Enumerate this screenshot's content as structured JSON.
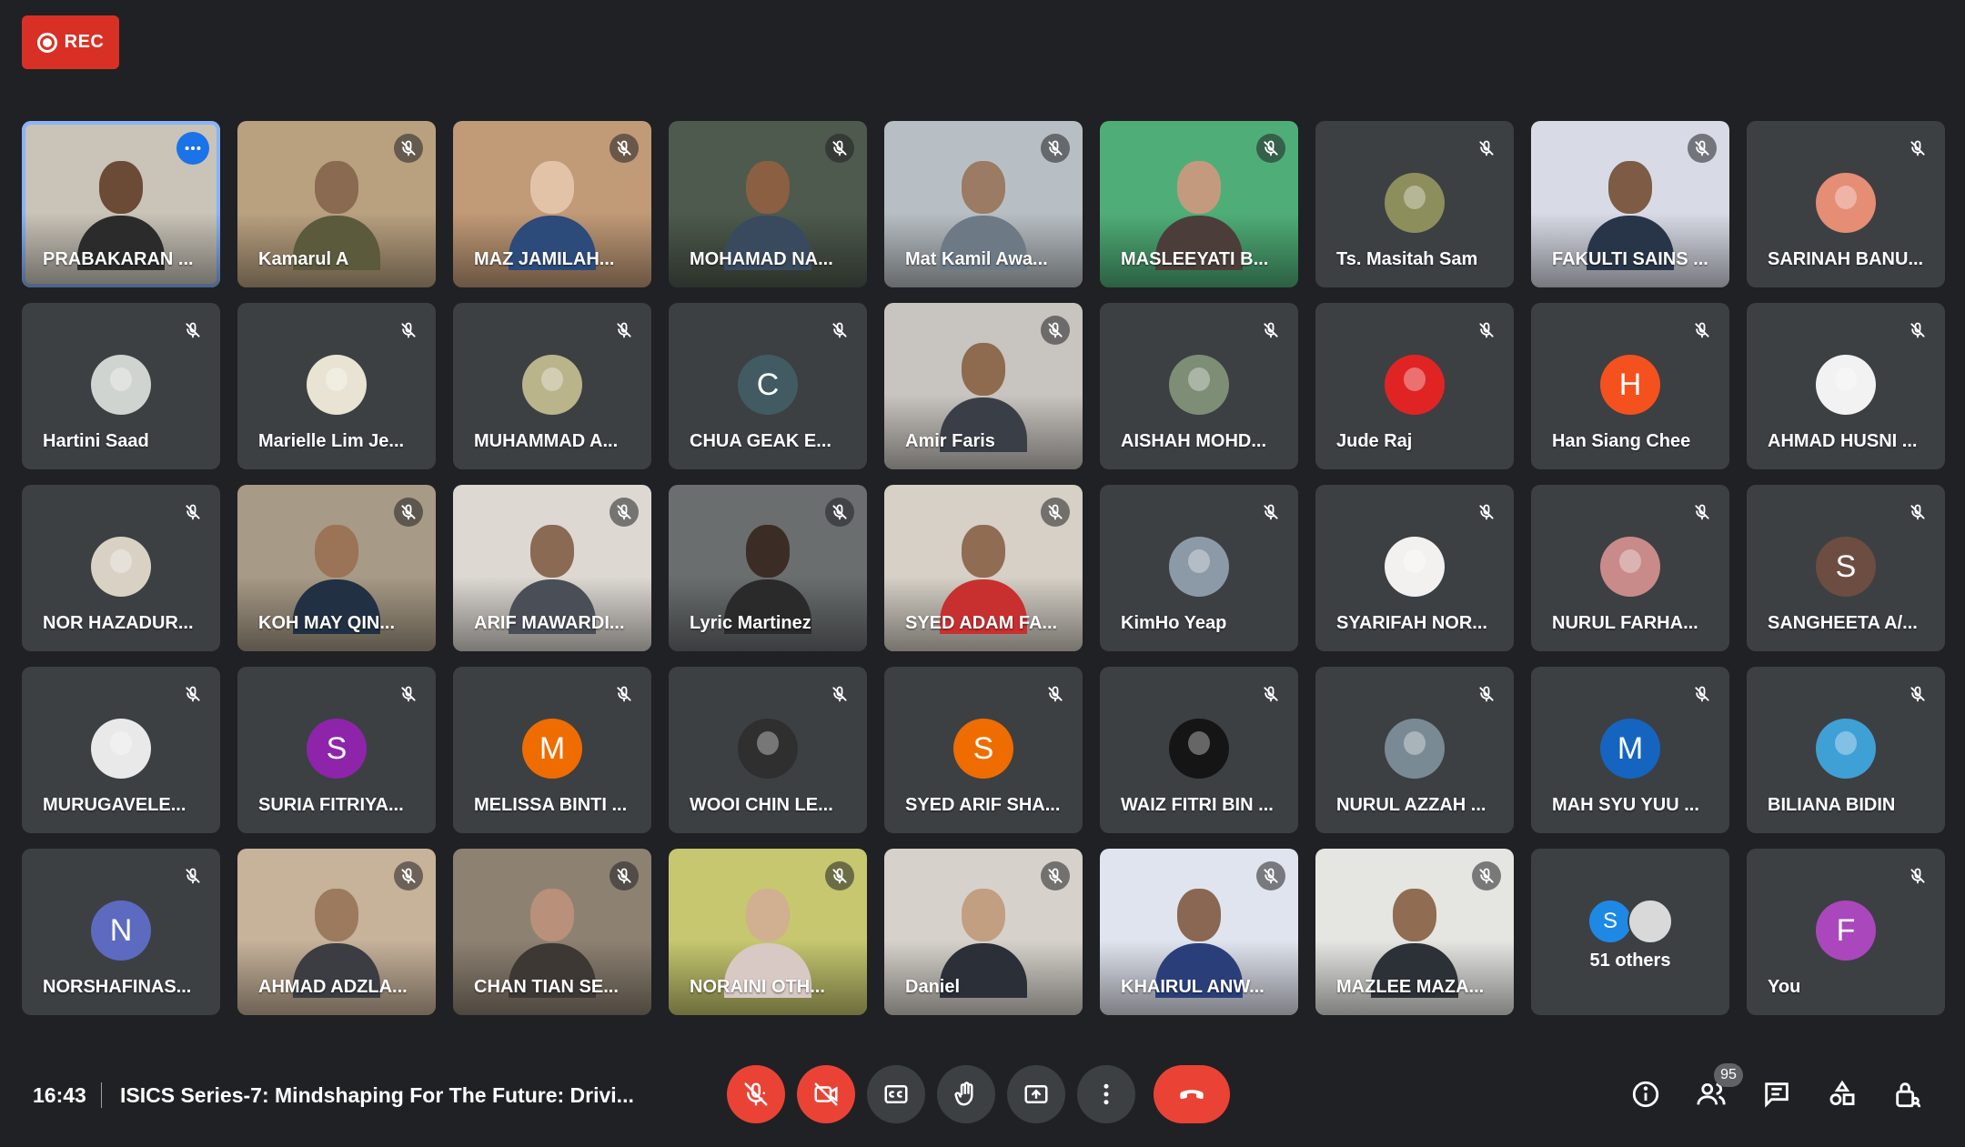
{
  "recording": {
    "label": "REC"
  },
  "participants": [
    {
      "name": "PRABAKARAN ...",
      "type": "video",
      "bg": "#c9c3b8",
      "skin": "#6b4a36",
      "shirt": "#2b2b2b",
      "active": true
    },
    {
      "name": "Kamarul A",
      "type": "video",
      "bg": "#b9a180",
      "skin": "#8a6a50",
      "shirt": "#5b5a3c"
    },
    {
      "name": "MAZ JAMILAH...",
      "type": "video",
      "bg": "#c19a77",
      "skin": "#e2c3a8",
      "shirt": "#2c4a7a"
    },
    {
      "name": "MOHAMAD NA...",
      "type": "video",
      "bg": "#4e5a4d",
      "skin": "#8a5f42",
      "shirt": "#394a5e"
    },
    {
      "name": "Mat Kamil Awa...",
      "type": "video",
      "bg": "#b8bfc4",
      "skin": "#9b7b63",
      "shirt": "#6d7a86"
    },
    {
      "name": "MASLEEYATI B...",
      "type": "video",
      "bg": "#4fae78",
      "skin": "#c49a7f",
      "shirt": "#4b3e3a"
    },
    {
      "name": "Ts. Masitah Sam",
      "type": "avatar",
      "color": "#8c8f5c",
      "photo": true
    },
    {
      "name": "FAKULTI SAINS ...",
      "type": "video",
      "bg": "#d8dbe6",
      "skin": "#7d5b45",
      "shirt": "#283549"
    },
    {
      "name": "SARINAH BANU...",
      "type": "avatar",
      "color": "#e58d75",
      "photo": true
    },
    {
      "name": "Hartini Saad",
      "type": "avatar",
      "color": "#cfd4d0",
      "photo": true
    },
    {
      "name": "Marielle Lim Je...",
      "type": "avatar",
      "color": "#e8e3d2",
      "photo": true
    },
    {
      "name": "MUHAMMAD A...",
      "type": "avatar",
      "color": "#b9b48a",
      "photo": true
    },
    {
      "name": "CHUA GEAK E...",
      "type": "avatar",
      "color": "#425b63",
      "initial": "C"
    },
    {
      "name": "Amir Faris",
      "type": "video",
      "bg": "#c8c4bf",
      "skin": "#8e6a4f",
      "shirt": "#3a3f47"
    },
    {
      "name": "AISHAH MOHD...",
      "type": "avatar",
      "color": "#7e8e76",
      "photo": true
    },
    {
      "name": "Jude Raj",
      "type": "avatar",
      "color": "#e02424",
      "photo": true
    },
    {
      "name": "Han Siang Chee",
      "type": "avatar",
      "color": "#f4511e",
      "initial": "H"
    },
    {
      "name": "AHMAD HUSNI ...",
      "type": "avatar",
      "color": "#f2f2f2",
      "photo": true
    },
    {
      "name": "NOR HAZADUR...",
      "type": "avatar",
      "color": "#d9d2c4",
      "photo": true
    },
    {
      "name": "KOH MAY QIN...",
      "type": "video",
      "bg": "#a79a86",
      "skin": "#9b7356",
      "shirt": "#223044"
    },
    {
      "name": "ARIF MAWARDI...",
      "type": "video",
      "bg": "#ddd8d2",
      "skin": "#8a6a52",
      "shirt": "#4a4e57"
    },
    {
      "name": "Lyric Martinez",
      "type": "video",
      "bg": "#6a6e6f",
      "skin": "#3b2d25",
      "shirt": "#2a2a2a"
    },
    {
      "name": "SYED ADAM FA...",
      "type": "video",
      "bg": "#d6d0c6",
      "skin": "#8f6c52",
      "shirt": "#c83030"
    },
    {
      "name": "KimHo Yeap",
      "type": "avatar",
      "color": "#8c9aa8",
      "photo": true
    },
    {
      "name": "SYARIFAH NOR...",
      "type": "avatar",
      "color": "#f3f1ef",
      "photo": true
    },
    {
      "name": "NURUL FARHA...",
      "type": "avatar",
      "color": "#c98a8a",
      "photo": true
    },
    {
      "name": "SANGHEETA A/...",
      "type": "avatar",
      "color": "#6d4c41",
      "initial": "S"
    },
    {
      "name": "MURUGAVELE...",
      "type": "avatar",
      "color": "#e9e9e9",
      "photo": true
    },
    {
      "name": "SURIA FITRIYA...",
      "type": "avatar",
      "color": "#8e24aa",
      "initial": "S"
    },
    {
      "name": "MELISSA BINTI ...",
      "type": "avatar",
      "color": "#ef6c00",
      "initial": "M"
    },
    {
      "name": "WOOI CHIN LE...",
      "type": "avatar",
      "color": "#2f2f2f",
      "photo": true
    },
    {
      "name": "SYED ARIF SHA...",
      "type": "avatar",
      "color": "#ef6c00",
      "initial": "S"
    },
    {
      "name": "WAIZ FITRI BIN ...",
      "type": "avatar",
      "color": "#151515",
      "photo": true
    },
    {
      "name": "NURUL AZZAH ...",
      "type": "avatar",
      "color": "#7a8a95",
      "photo": true
    },
    {
      "name": "MAH SYU YUU ...",
      "type": "avatar",
      "color": "#1565c0",
      "initial": "M"
    },
    {
      "name": "BILIANA BIDIN",
      "type": "avatar",
      "color": "#3fa0d6",
      "photo": true
    },
    {
      "name": "NORSHAFINAS...",
      "type": "avatar",
      "color": "#5c6bc0",
      "initial": "N"
    },
    {
      "name": "AHMAD ADZLA...",
      "type": "video",
      "bg": "#c7b29a",
      "skin": "#9c7a5e",
      "shirt": "#3b3d42"
    },
    {
      "name": "CHAN TIAN SE...",
      "type": "video",
      "bg": "#8d8172",
      "skin": "#b9907a",
      "shirt": "#3d3834"
    },
    {
      "name": "NORAINI OTH...",
      "type": "video",
      "bg": "#c6c76f",
      "skin": "#d0b090",
      "shirt": "#d9c9c4"
    },
    {
      "name": "Daniel",
      "type": "video",
      "bg": "#d6d2cb",
      "skin": "#c29f80",
      "shirt": "#2a2f38"
    },
    {
      "name": "KHAIRUL ANW...",
      "type": "video",
      "bg": "#e0e4ee",
      "skin": "#8a6752",
      "shirt": "#2a3f7a"
    },
    {
      "name": "MAZLEE MAZA...",
      "type": "video",
      "bg": "#e5e5e2",
      "skin": "#8f6c52",
      "shirt": "#2b3136"
    },
    {
      "name": "51 others",
      "type": "others",
      "mini": [
        {
          "initial": "S",
          "color": "#1e88e5"
        },
        {
          "initial": "",
          "color": "#d9d9d9"
        }
      ]
    },
    {
      "name": "You",
      "type": "avatar",
      "color": "#ab47bc",
      "initial": "F"
    }
  ],
  "bottom_bar": {
    "time": "16:43",
    "meeting_title": "ISICS Series-7: Mindshaping For The Future: Drivi...",
    "people_count": "95"
  },
  "icons": {
    "mic_off": "mic-off-icon",
    "camera_off": "camera-off-icon",
    "captions": "captions-icon",
    "raise_hand": "hand-icon",
    "present": "present-icon",
    "more": "more-vert-icon",
    "leave": "call-end-icon",
    "info": "info-icon",
    "people": "people-icon",
    "chat": "chat-icon",
    "activities": "activities-icon",
    "host_controls": "lock-person-icon"
  }
}
